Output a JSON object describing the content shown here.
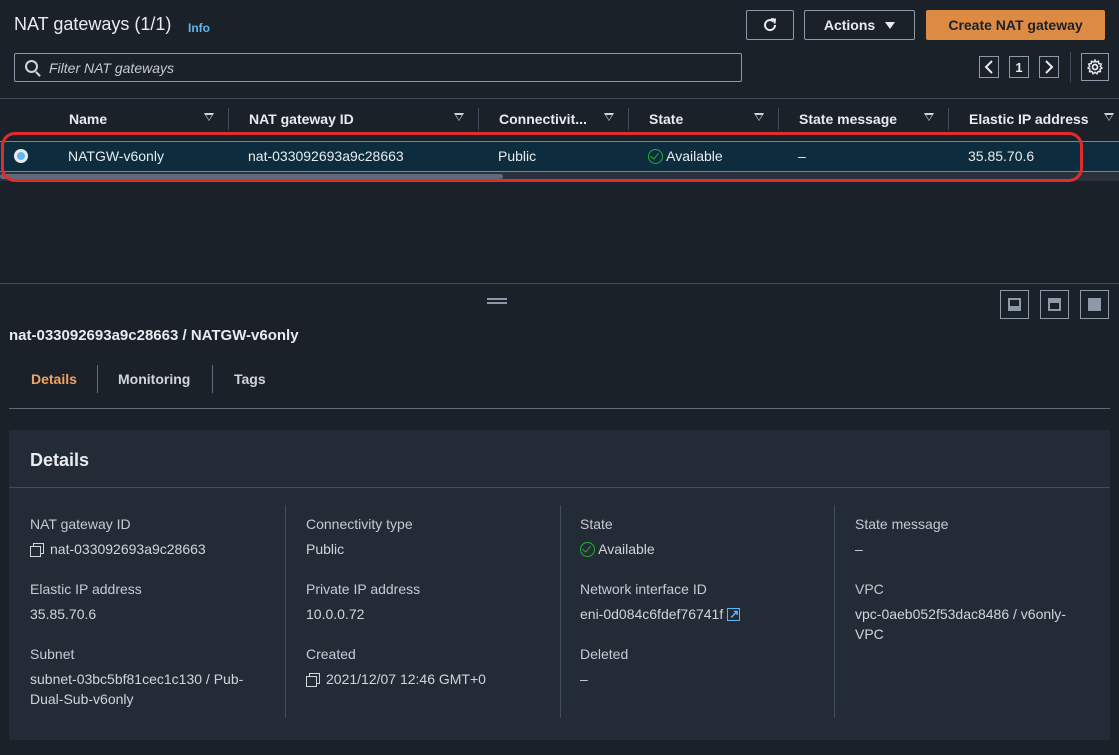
{
  "header": {
    "title": "NAT gateways (1/1)",
    "info": "Info",
    "actions_label": "Actions",
    "create_label": "Create NAT gateway"
  },
  "search": {
    "placeholder": "Filter NAT gateways"
  },
  "pager": {
    "page": "1",
    "prev": "‹",
    "next": "›"
  },
  "table": {
    "columns": [
      "Name",
      "NAT gateway ID",
      "Connectivit...",
      "State",
      "State message",
      "Elastic IP address"
    ],
    "rows": [
      {
        "name": "NATGW-v6only",
        "id": "nat-033092693a9c28663",
        "connectivity": "Public",
        "state": "Available",
        "state_message": "–",
        "eip": "35.85.70.6",
        "selected": true
      }
    ]
  },
  "detail": {
    "subtitle": "nat-033092693a9c28663 / NATGW-v6only",
    "tabs": [
      "Details",
      "Monitoring",
      "Tags"
    ],
    "panel_title": "Details",
    "fields": {
      "nat_id_label": "NAT gateway ID",
      "nat_id": "nat-033092693a9c28663",
      "eip_label": "Elastic IP address",
      "eip": "35.85.70.6",
      "subnet_label": "Subnet",
      "subnet_line1": "subnet-03bc5bf81cec1c130 / Pub-",
      "subnet_line2": "Dual-Sub-v6only",
      "conn_label": "Connectivity type",
      "conn": "Public",
      "private_ip_label": "Private IP address",
      "private_ip": "10.0.0.72",
      "created_label": "Created",
      "created": "2021/12/07 12:46 GMT+0",
      "state_label": "State",
      "state": "Available",
      "eni_label": "Network interface ID",
      "eni": "eni-0d084c6fdef76741f",
      "deleted_label": "Deleted",
      "deleted": "–",
      "state_msg_label": "State message",
      "state_msg": "–",
      "vpc_label": "VPC",
      "vpc_line1": "vpc-0aeb052f53dac8486 / v6only-",
      "vpc_line2": "VPC"
    }
  },
  "colors": {
    "accent": "#dd8a44",
    "link": "#5fb7f2",
    "success": "#29ad32",
    "highlight": "#e02c2c",
    "active_tab": "#f2a462"
  }
}
